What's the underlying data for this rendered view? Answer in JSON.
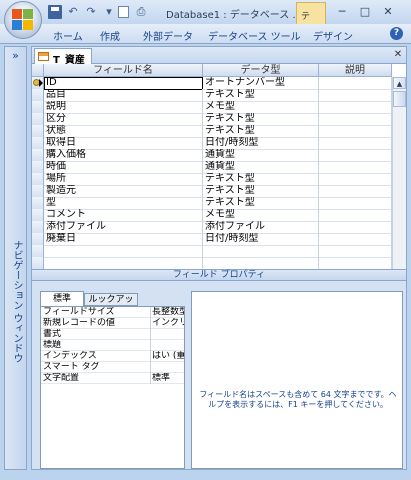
{
  "title_bar": {
    "title": "Database1 : データベース ...",
    "context_tab": "テ",
    "window_buttons": [
      "─",
      "□",
      "✕"
    ]
  },
  "quick_access": {
    "undo": "↶",
    "redo": "↷",
    "more": "▾"
  },
  "ribbon": {
    "tabs": [
      "ホーム",
      "作成",
      "外部データ",
      "データベース ツール",
      "デザイン"
    ],
    "help": "?"
  },
  "nav_pane": {
    "chevron": "»",
    "label": "ナビゲーション ウィンドウ"
  },
  "document": {
    "tab_title": "T_資産",
    "close": "✕",
    "columns": [
      "フィールド名",
      "データ型",
      "説明"
    ],
    "rows": [
      {
        "field": "ID",
        "type": "オートナンバー型"
      },
      {
        "field": "品目",
        "type": "テキスト型"
      },
      {
        "field": "説明",
        "type": "メモ型"
      },
      {
        "field": "区分",
        "type": "テキスト型"
      },
      {
        "field": "状態",
        "type": "テキスト型"
      },
      {
        "field": "取得日",
        "type": "日付/時刻型"
      },
      {
        "field": "購入価格",
        "type": "通貨型"
      },
      {
        "field": "時価",
        "type": "通貨型"
      },
      {
        "field": "場所",
        "type": "テキスト型"
      },
      {
        "field": "製造元",
        "type": "テキスト型"
      },
      {
        "field": "型",
        "type": "テキスト型"
      },
      {
        "field": "コメント",
        "type": "メモ型"
      },
      {
        "field": "添付ファイル",
        "type": "添付ファイル"
      },
      {
        "field": "廃棄日",
        "type": "日付/時刻型"
      },
      {
        "field": "",
        "type": ""
      },
      {
        "field": "",
        "type": ""
      }
    ],
    "scroll_up": "▲"
  },
  "field_properties": {
    "header": "フィールド プロパティ",
    "tabs": {
      "standard": "標準",
      "lookup": "ルックアップ"
    },
    "properties": [
      {
        "label": "フィールドサイズ",
        "value": "長整数型"
      },
      {
        "label": "新規レコードの値",
        "value": "インクリメ"
      },
      {
        "label": "書式",
        "value": ""
      },
      {
        "label": "標題",
        "value": ""
      },
      {
        "label": "インデックス",
        "value": "はい (重"
      },
      {
        "label": "スマート タグ",
        "value": ""
      },
      {
        "label": "文字配置",
        "value": "標準"
      }
    ],
    "help_text": "フィールド名はスペースも含めて 64 文字までです。ヘルプを表示するには、F1 キーを押してください。"
  }
}
